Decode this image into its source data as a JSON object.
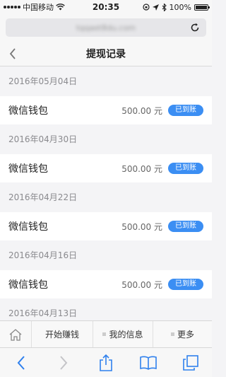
{
  "status_bar": {
    "carrier": "中国移动",
    "time": "20:35",
    "battery": "100%"
  },
  "browser": {
    "url": "tqqaet8du.com"
  },
  "navbar": {
    "title": "提现记录"
  },
  "records": [
    {
      "date": "2016年05月04日",
      "name": "微信钱包",
      "amount": "500.00 元",
      "status": "已到账"
    },
    {
      "date": "2016年04月30日",
      "name": "微信钱包",
      "amount": "500.00 元",
      "status": "已到账"
    },
    {
      "date": "2016年04月22日",
      "name": "微信钱包",
      "amount": "500.00 元",
      "status": "已到账"
    },
    {
      "date": "2016年04月16日",
      "name": "微信钱包",
      "amount": "500.00 元",
      "status": "已到账"
    },
    {
      "date": "2016年04月13日"
    }
  ],
  "tab_bar": {
    "tabs": [
      {
        "label": "开始赚钱"
      },
      {
        "label": "我的信息"
      },
      {
        "label": "更多"
      }
    ]
  },
  "colors": {
    "accent": "#3b8ef3",
    "background": "#f4f4f6"
  }
}
